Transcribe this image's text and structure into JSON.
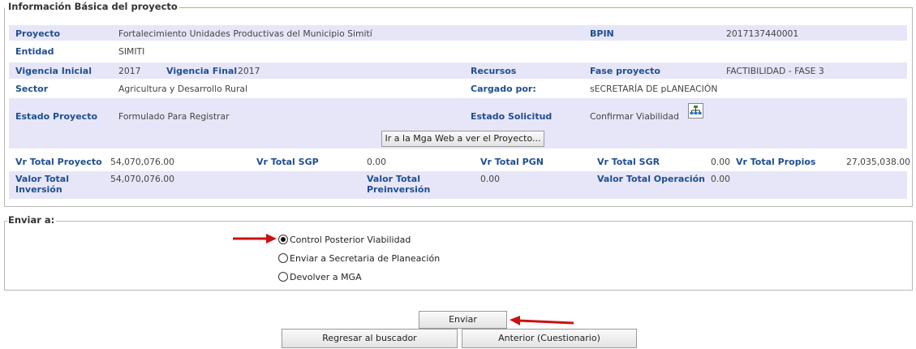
{
  "basic": {
    "legend": "Información Básica del proyecto",
    "proyecto_label": "Proyecto",
    "proyecto_value": "Fortalecimiento Unidades Productivas del Municipio Simití",
    "bpin_label": "BPIN",
    "bpin_value": "2017137440001",
    "entidad_label": "Entidad",
    "entidad_value": "SIMITI",
    "vig_ini_label": "Vigencia Inicial",
    "vig_ini_value": "2017",
    "vig_fin_label": "Vigencia Final",
    "vig_fin_value": "2017",
    "recursos_label": "Recursos",
    "fase_label": "Fase proyecto",
    "fase_value": "FACTIBILIDAD - FASE 3",
    "sector_label": "Sector",
    "sector_value": "Agricultura y Desarrollo Rural",
    "cargado_label": "Cargado por:",
    "cargado_value": "sECRETARÍA DE pLANEACIÓN",
    "estado_proy_label": "Estado Proyecto",
    "estado_proy_value": "Formulado Para Registrar",
    "estado_sol_label": "Estado Solicitud",
    "estado_sol_value": "Confirmar Viabilidad",
    "mga_button": "Ir a la Mga Web a ver el Proyecto...",
    "vr_total_proy_label": "Vr Total Proyecto",
    "vr_total_proy_value": "54,070,076.00",
    "vr_sgp_label": "Vr Total SGP",
    "vr_sgp_value": "0.00",
    "vr_pgn_label": "Vr Total PGN",
    "vr_sgr_label": "Vr Total SGR",
    "vr_sgr_value": "0.00",
    "vr_propios_label": "Vr Total Propios",
    "vr_propios_value": "27,035,038.00",
    "valor_inv_label_1": "Valor Total",
    "valor_inv_label_2": "Inversión",
    "valor_inv_value": "54,070,076.00",
    "valor_preinv_label_1": "Valor Total",
    "valor_preinv_label_2": "Preinversión",
    "valor_preinv_value": "0.00",
    "valor_oper_label": "Valor Total Operación",
    "valor_oper_value": "0.00"
  },
  "enviar": {
    "legend": "Enviar a:",
    "options": [
      {
        "label": "Control Posterior Viabilidad",
        "selected": true
      },
      {
        "label": "Enviar a Secretaria de Planeación",
        "selected": false
      },
      {
        "label": "Devolver a MGA",
        "selected": false
      }
    ]
  },
  "actions": {
    "enviar": "Enviar",
    "regresar": "Regresar al buscador",
    "anterior": "Anterior (Cuestionario)"
  },
  "colors": {
    "row_band": "#e6e6f8",
    "label_blue": "#1f4f8f",
    "arrow_red": "#cc1111",
    "accent_green": "#9acd32"
  }
}
